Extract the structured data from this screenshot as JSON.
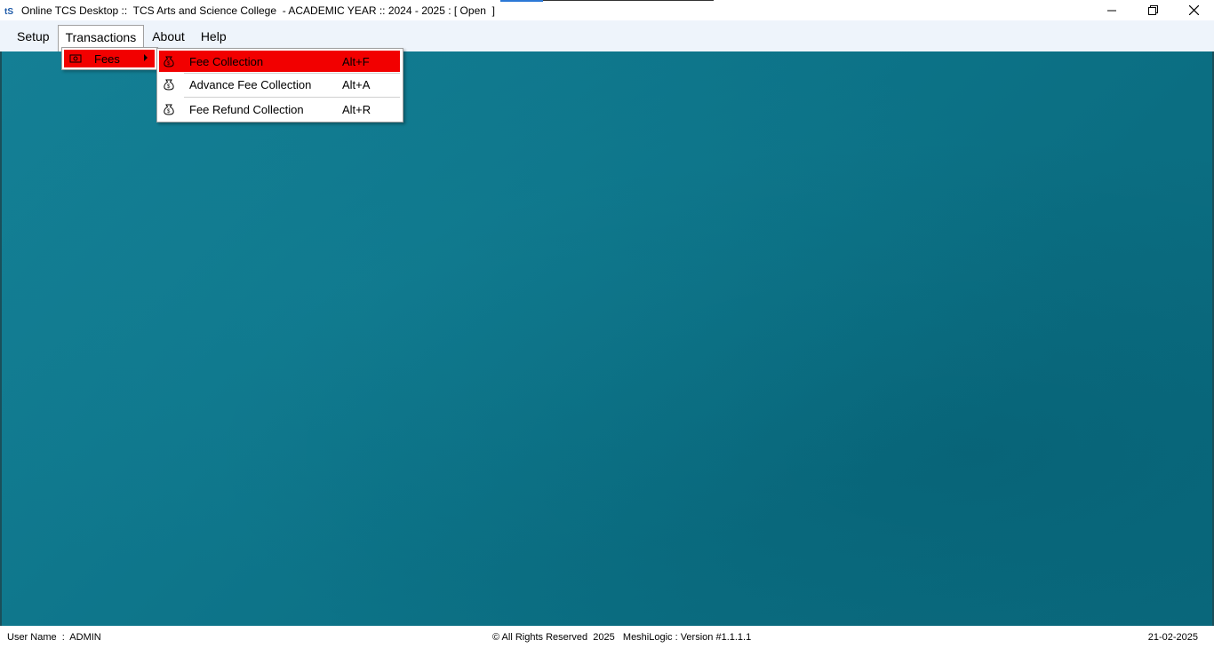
{
  "window": {
    "title": "Online TCS Desktop ::  TCS Arts and Science College  - ACADEMIC YEAR :: 2024 - 2025 : [ Open  ]",
    "controls": {
      "minimize": "—",
      "restore": "❐",
      "close": "✕"
    }
  },
  "menubar": {
    "items": [
      {
        "label": "Setup"
      },
      {
        "label": "Transactions"
      },
      {
        "label": "About"
      },
      {
        "label": "Help"
      }
    ]
  },
  "transactions_menu": {
    "items": [
      {
        "label": "Fees",
        "icon": "fees-icon"
      }
    ]
  },
  "fees_submenu": {
    "items": [
      {
        "label": "Fee Collection",
        "shortcut": "Alt+F",
        "icon": "money-bag-icon"
      },
      {
        "label": "Advance Fee Collection",
        "shortcut": "Alt+A",
        "icon": "money-bag-icon"
      },
      {
        "label": "Fee Refund Collection",
        "shortcut": "Alt+R",
        "icon": "money-bag-icon"
      }
    ]
  },
  "statusbar": {
    "user": "User Name  :  ADMIN",
    "copyright": "© All Rights Reserved  2025   MeshiLogic : Version #1.1.1.1",
    "date": "21-02-2025"
  },
  "colors": {
    "highlight": "#f20000",
    "desktop": "#0d7489",
    "menubar": "#eef4fb"
  }
}
